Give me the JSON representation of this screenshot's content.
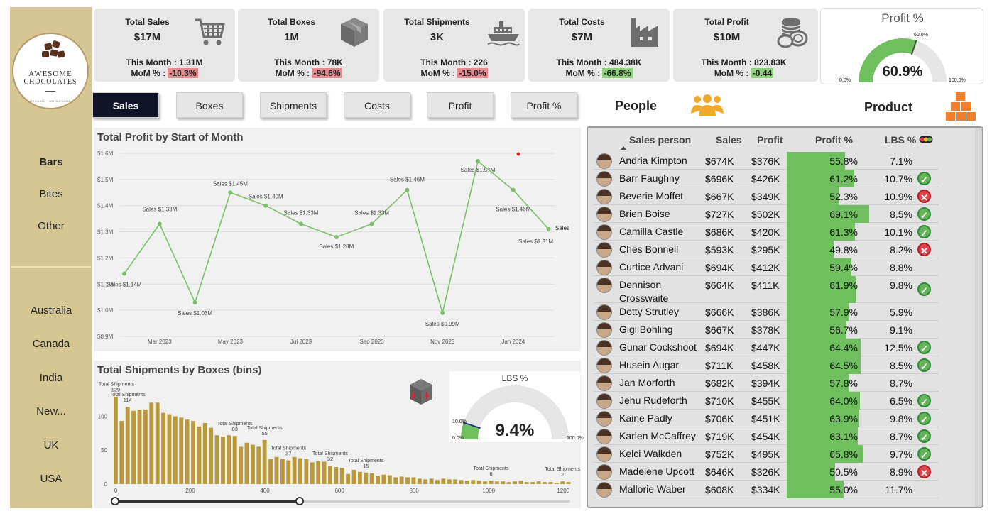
{
  "brand": {
    "line1": "AWESOME",
    "line2": "CHOCOLATES",
    "tagline": "ORGANIC · WHOLESOME"
  },
  "sidebar": {
    "categories": [
      "Bars",
      "Bites",
      "Other"
    ],
    "active_category": "Bars",
    "countries": [
      "Australia",
      "Canada",
      "India",
      "New...",
      "UK",
      "USA"
    ]
  },
  "kpis": [
    {
      "title": "Total Sales",
      "value": "$17M",
      "month": "This Month : 1.31M",
      "mom_label": "MoM % : ",
      "mom": "-10.3%",
      "mom_color": "#e58a8f",
      "icon": "cart-icon"
    },
    {
      "title": "Total Boxes",
      "value": "1M",
      "month": "This Month : 78K",
      "mom_label": "MoM % : ",
      "mom": "-94.6%",
      "mom_color": "#e58a8f",
      "icon": "box-icon"
    },
    {
      "title": "Total Shipments",
      "value": "3K",
      "month": "This Month : 226",
      "mom_label": "MoM % : ",
      "mom": "-15.0%",
      "mom_color": "#e58a8f",
      "icon": "ship-icon"
    },
    {
      "title": "Total Costs",
      "value": "$7M",
      "month": "This Month : 484.38K",
      "mom_label": "MoM % : ",
      "mom": "-66.8%",
      "mom_color": "#8fd17e",
      "icon": "factory-icon"
    },
    {
      "title": "Total Profit",
      "value": "$10M",
      "month": "This Month : 823.83K",
      "mom_label": "MoM % : ",
      "mom": "-0.44",
      "mom_color": "#8fd17e",
      "icon": "coins-icon"
    }
  ],
  "profit_gauge": {
    "title": "Profit %",
    "value": "60.9%",
    "fraction": 0.609,
    "min": "0.0%",
    "max": "100.0%",
    "target": "60.0%",
    "color": "#6fbf5e"
  },
  "tabs": [
    "Sales",
    "Boxes",
    "Shipments",
    "Costs",
    "Profit",
    "Profit %"
  ],
  "active_tab": "Sales",
  "sections": {
    "people": "People",
    "product": "Product"
  },
  "line_chart": {
    "title": "Total Profit by Start of Month",
    "series_label": "Sales",
    "y_ticks": [
      "$1.6M",
      "$1.5M",
      "$1.4M",
      "$1.3M",
      "$1.2M",
      "$1.1M",
      "$1.0M",
      "$0.9M"
    ],
    "x_ticks": [
      "Mar 2023",
      "May 2023",
      "Jul 2023",
      "Sep 2023",
      "Nov 2023",
      "Jan 2024"
    ]
  },
  "bar_chart": {
    "title": "Total Shipments by Boxes (bins)",
    "label_prefix": "Total Shipments",
    "y_ticks": [
      "100",
      "50",
      "0"
    ],
    "x_ticks": [
      "0",
      "200",
      "400",
      "600",
      "800",
      "1000",
      "1200"
    ]
  },
  "lbs_gauge": {
    "title": "LBS %",
    "value": "9.4%",
    "fraction": 0.094,
    "min": "0.0%",
    "max": "100.0%",
    "target": "10.0%",
    "color": "#6fbf5e"
  },
  "table": {
    "headers": {
      "name": "Sales person",
      "sales": "Sales",
      "profit": "Profit",
      "profit_pct": "Profit %",
      "lbs": "LBS %"
    },
    "rows": [
      {
        "name": "Andria Kimpton",
        "sales": "$674K",
        "profit": "$376K",
        "profit_pct": "55.8%",
        "lbs": "7.1%",
        "status": ""
      },
      {
        "name": "Barr Faughny",
        "sales": "$696K",
        "profit": "$426K",
        "profit_pct": "61.2%",
        "lbs": "10.7%",
        "status": "good"
      },
      {
        "name": "Beverie Moffet",
        "sales": "$667K",
        "profit": "$349K",
        "profit_pct": "52.3%",
        "lbs": "10.9%",
        "status": "bad"
      },
      {
        "name": "Brien Boise",
        "sales": "$727K",
        "profit": "$502K",
        "profit_pct": "69.1%",
        "lbs": "8.5%",
        "status": "good"
      },
      {
        "name": "Camilla Castle",
        "sales": "$686K",
        "profit": "$420K",
        "profit_pct": "61.3%",
        "lbs": "10.1%",
        "status": "good"
      },
      {
        "name": "Ches Bonnell",
        "sales": "$593K",
        "profit": "$295K",
        "profit_pct": "49.8%",
        "lbs": "8.2%",
        "status": "bad"
      },
      {
        "name": "Curtice Advani",
        "sales": "$694K",
        "profit": "$412K",
        "profit_pct": "59.4%",
        "lbs": "8.8%",
        "status": ""
      },
      {
        "name": "Dennison Crosswaite",
        "sales": "$664K",
        "profit": "$411K",
        "profit_pct": "61.9%",
        "lbs": "9.8%",
        "status": "good"
      },
      {
        "name": "Dotty Strutley",
        "sales": "$666K",
        "profit": "$386K",
        "profit_pct": "57.9%",
        "lbs": "5.9%",
        "status": ""
      },
      {
        "name": "Gigi Bohling",
        "sales": "$667K",
        "profit": "$378K",
        "profit_pct": "56.7%",
        "lbs": "9.1%",
        "status": ""
      },
      {
        "name": "Gunar Cockshoot",
        "sales": "$694K",
        "profit": "$447K",
        "profit_pct": "64.4%",
        "lbs": "12.5%",
        "status": "good"
      },
      {
        "name": "Husein Augar",
        "sales": "$711K",
        "profit": "$458K",
        "profit_pct": "64.5%",
        "lbs": "8.5%",
        "status": "good"
      },
      {
        "name": "Jan Morforth",
        "sales": "$682K",
        "profit": "$394K",
        "profit_pct": "57.8%",
        "lbs": "8.7%",
        "status": ""
      },
      {
        "name": "Jehu Rudeforth",
        "sales": "$710K",
        "profit": "$455K",
        "profit_pct": "64.0%",
        "lbs": "6.5%",
        "status": "good"
      },
      {
        "name": "Kaine Padly",
        "sales": "$706K",
        "profit": "$451K",
        "profit_pct": "63.9%",
        "lbs": "9.8%",
        "status": "good"
      },
      {
        "name": "Karlen McCaffrey",
        "sales": "$719K",
        "profit": "$454K",
        "profit_pct": "63.1%",
        "lbs": "8.7%",
        "status": "good"
      },
      {
        "name": "Kelci Walkden",
        "sales": "$752K",
        "profit": "$495K",
        "profit_pct": "65.8%",
        "lbs": "9.7%",
        "status": "good"
      },
      {
        "name": "Madelene Upcott",
        "sales": "$646K",
        "profit": "$326K",
        "profit_pct": "50.5%",
        "lbs": "8.9%",
        "status": "bad"
      },
      {
        "name": "Mallorie Waber",
        "sales": "$608K",
        "profit": "$334K",
        "profit_pct": "55.0%",
        "lbs": "11.7%",
        "status": ""
      }
    ]
  },
  "chart_data": [
    {
      "type": "line",
      "title": "Total Profit by Start of Month",
      "x": [
        "Feb 2023",
        "Mar 2023",
        "Apr 2023",
        "May 2023",
        "Jun 2023",
        "Jul 2023",
        "Aug 2023",
        "Sep 2023",
        "Oct 2023",
        "Nov 2023",
        "Dec 2023",
        "Jan 2024",
        "Feb 2024"
      ],
      "series": [
        {
          "name": "Sales",
          "values": [
            1.14,
            1.33,
            1.03,
            1.45,
            1.4,
            1.33,
            1.28,
            1.33,
            1.46,
            0.99,
            1.57,
            1.46,
            1.31
          ]
        }
      ],
      "point_labels": [
        "Sales $1.14M",
        "Sales $1.33M",
        "Sales $1.03M",
        "Sales $1.45M",
        "Sales $1.40M",
        "Sales $1.33M",
        "Sales $1.28M",
        "Sales $1.33M",
        "Sales $1.46M",
        "Sales $0.99M",
        "Sales $1.57M",
        "Sales $1.46M",
        "Sales $1.31M"
      ],
      "ylim": [
        0.9,
        1.6
      ],
      "y_unit": "$M",
      "color": "#7cc06a",
      "grid": true
    },
    {
      "type": "bar",
      "title": "Total Shipments by Boxes (bins)",
      "values": [
        129,
        93,
        114,
        108,
        110,
        110,
        120,
        120,
        105,
        103,
        100,
        98,
        95,
        93,
        85,
        90,
        83,
        72,
        70,
        72,
        71,
        55,
        61,
        58,
        55,
        65,
        37,
        40,
        37,
        35,
        40,
        38,
        37,
        32,
        34,
        33,
        27,
        25,
        24,
        15,
        21,
        18,
        17,
        16,
        12,
        14,
        13,
        10,
        11,
        10,
        10,
        8,
        7,
        8,
        6,
        8,
        7,
        7,
        6,
        5,
        6,
        5,
        4,
        5,
        4,
        4,
        3,
        4,
        5,
        3,
        3,
        4,
        3,
        3,
        2,
        4,
        3
      ],
      "labelled": {
        "0": "129",
        "2": "114",
        "20": "83",
        "25": "55",
        "29": "37",
        "36": "32",
        "42": "15",
        "63": "6",
        "75": "2"
      },
      "xlim": [
        0,
        1230
      ],
      "ylim": [
        0,
        135
      ],
      "color": "#b89a3c",
      "grid": false
    }
  ]
}
